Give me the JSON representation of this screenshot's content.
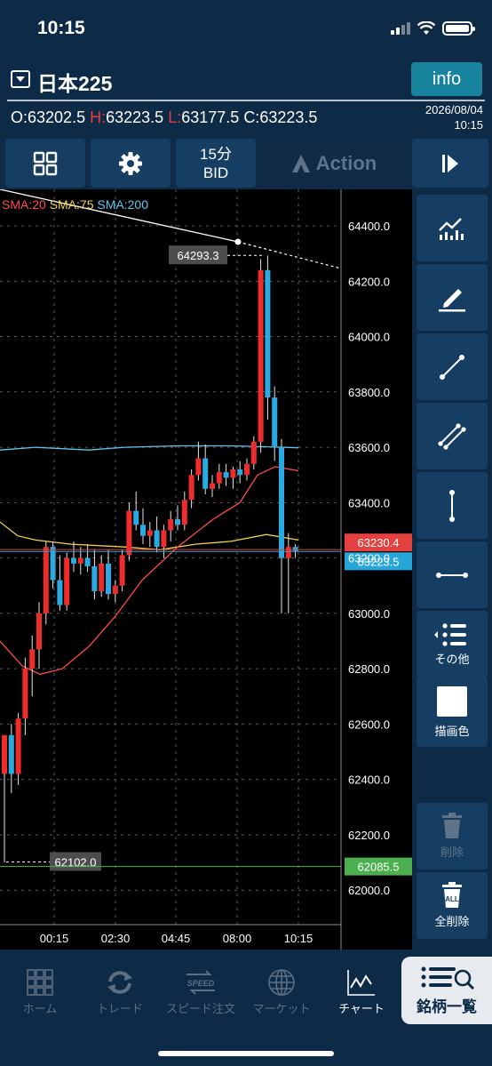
{
  "status_bar": {
    "time": "10:15"
  },
  "header": {
    "symbol": "日本225",
    "info_label": "info",
    "ohlc": {
      "o_label": "O:",
      "o": "63202.5",
      "h_label": "H:",
      "h": "63223.5",
      "l_label": "L:",
      "l": "63177.5",
      "c_label": "C:",
      "c": "63223.5"
    },
    "date": "2026/08/04",
    "time": "10:15"
  },
  "toolbar": {
    "timeframe": "15分",
    "price_type": "BID",
    "action_label": "Action"
  },
  "chart": {
    "legend": [
      {
        "label": "SMA:20",
        "color": "#ff4d4d"
      },
      {
        "label": "SMA:75",
        "color": "#f2d24b"
      },
      {
        "label": "SMA:200",
        "color": "#5fc8f0"
      }
    ],
    "price_ticks": [
      "64400.0",
      "64200.0",
      "64000.0",
      "63800.0",
      "63600.0",
      "63400.0",
      "63200.0",
      "63000.0",
      "62800.0",
      "62600.0",
      "62400.0",
      "62200.0",
      "62000.0"
    ],
    "time_ticks": [
      "00:15",
      "02:30",
      "04:45",
      "08:00",
      "10:15"
    ],
    "high_label": "64293.3",
    "low_label": "62102.0",
    "ask_price": "63230.4",
    "bid_price": "63223.5",
    "support_price": "62085.5",
    "colors": {
      "up": "#ee2c2c",
      "down": "#2aaae2",
      "ask": "#e34040",
      "bid": "#26a6d8",
      "support": "#4caf50"
    }
  },
  "sidebar": {
    "others_label": "その他",
    "color_label": "描画色",
    "delete_label": "削除",
    "delete_all_label": "全削除",
    "all_badge": "ALL"
  },
  "tabs": [
    {
      "label": "ホーム",
      "icon": "grid-icon"
    },
    {
      "label": "トレード",
      "icon": "refresh-icon"
    },
    {
      "label": "スピード注文",
      "icon": "speed-icon"
    },
    {
      "label": "マーケット",
      "icon": "globe-icon"
    },
    {
      "label": "チャート",
      "icon": "chart-icon"
    }
  ],
  "speed_badge": "SPEED",
  "search_list_label": "銘柄一覧"
}
